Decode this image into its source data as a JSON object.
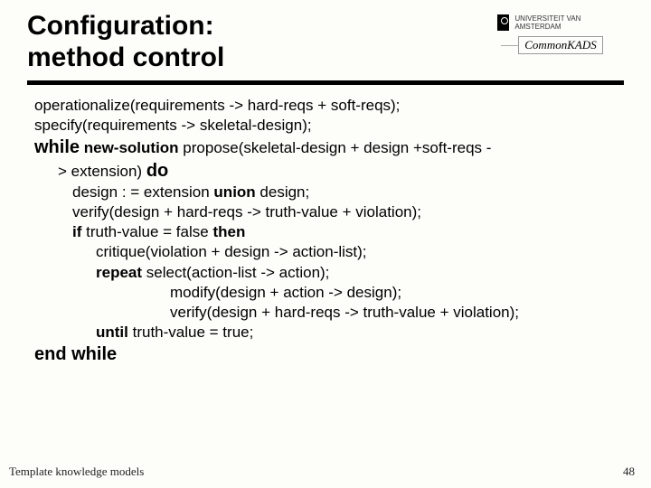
{
  "title_line1": "Configuration:",
  "title_line2": "method control",
  "logo_uva_text": "UNIVERSITEIT VAN AMSTERDAM",
  "logo_ck_text": "CommonKADS",
  "lines": {
    "l1": "operationalize(requirements -> hard-reqs + soft-reqs);",
    "l2": "specify(requirements -> skeletal-design);",
    "l3a": "while",
    "l3b": " new-solution ",
    "l3c": "propose(skeletal-design + design +soft-reqs -",
    "l4a": "> extension) ",
    "l4b": "do",
    "l5a": "design : = extension ",
    "l5b": "union",
    "l5c": " design;",
    "l6": "verify(design + hard-reqs -> truth-value + violation);",
    "l7a": "if",
    "l7b": " truth-value = false ",
    "l7c": "then",
    "l8": "critique(violation + design -> action-list);",
    "l9a": "repeat",
    "l9b": "  select(action-list -> action);",
    "l10": "modify(design + action -> design);",
    "l11": "verify(design + hard-reqs -> truth-value + violation);",
    "l12a": "until",
    "l12b": " truth-value = true;",
    "l13": "end while"
  },
  "footer_left": "Template knowledge models",
  "footer_right": "48"
}
